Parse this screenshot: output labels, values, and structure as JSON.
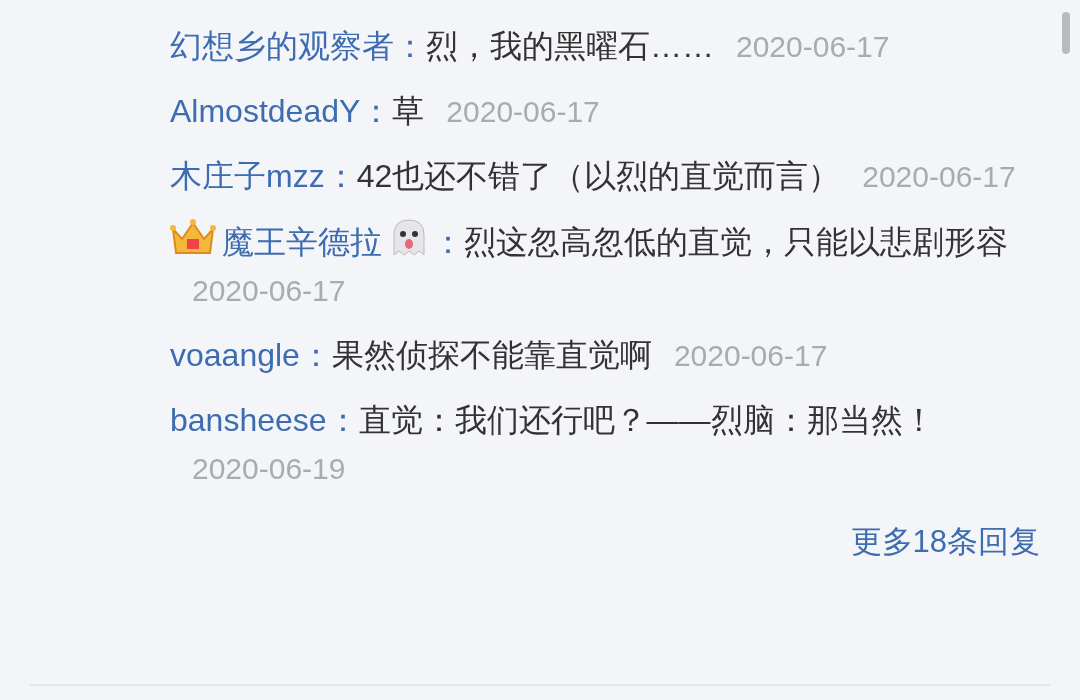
{
  "replies": [
    {
      "name": "幻想乡的观察者",
      "vip_badge": false,
      "ghost_emoji": false,
      "separator": "：",
      "text": "烈，我的黑曜石……",
      "date": "2020-06-17"
    },
    {
      "name": "AlmostdeadY",
      "vip_badge": false,
      "ghost_emoji": false,
      "separator": "：",
      "text": "草",
      "date": "2020-06-17"
    },
    {
      "name": "木庄子mzz",
      "vip_badge": false,
      "ghost_emoji": false,
      "separator": "：",
      "text": "42也还不错了（以烈的直觉而言）",
      "date": "2020-06-17"
    },
    {
      "name": "魔王辛德拉",
      "vip_badge": true,
      "ghost_emoji": true,
      "separator": "：",
      "text": "烈这忽高忽低的直觉，只能以悲剧形容",
      "date": "2020-06-17"
    },
    {
      "name": "voaangle",
      "vip_badge": false,
      "ghost_emoji": false,
      "separator": "：",
      "text": "果然侦探不能靠直觉啊",
      "date": "2020-06-17"
    },
    {
      "name": "bansheese",
      "vip_badge": false,
      "ghost_emoji": false,
      "separator": "：",
      "text": "直觉：我们还行吧？——烈脑：那当然！",
      "date": "2020-06-19"
    }
  ],
  "more_link": "更多18条回复"
}
